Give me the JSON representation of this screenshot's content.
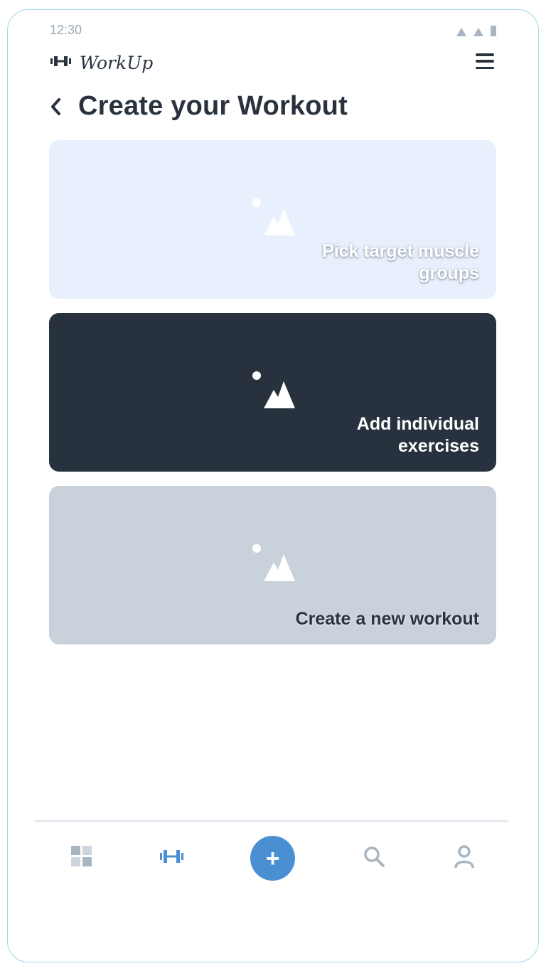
{
  "status_bar": {
    "time": "12:30"
  },
  "app": {
    "name": "WorkUp",
    "logo_icon": "dumbbell-icon",
    "menu_icon": "hamburger-menu-icon"
  },
  "page": {
    "title": "Create your Workout",
    "back_icon": "chevron-left-icon"
  },
  "cards": [
    {
      "label": "Pick target muscle groups",
      "icon": "image-placeholder-icon",
      "background": "#e7f0fc"
    },
    {
      "label": "Add individual exercises",
      "icon": "image-placeholder-icon",
      "background": "#28323e"
    },
    {
      "label": "Create a new workout",
      "icon": "image-placeholder-icon",
      "background": "#c9d1db"
    }
  ],
  "bottom_nav": {
    "items": [
      {
        "icon": "grid-icon"
      },
      {
        "icon": "dumbbell-icon",
        "active": true
      },
      {
        "icon": "plus-icon",
        "label": "+"
      },
      {
        "icon": "search-icon"
      },
      {
        "icon": "user-icon"
      }
    ]
  },
  "colors": {
    "accent": "#4a8fd1",
    "text_dark": "#29323d",
    "icon_muted": "#aab5c2"
  }
}
